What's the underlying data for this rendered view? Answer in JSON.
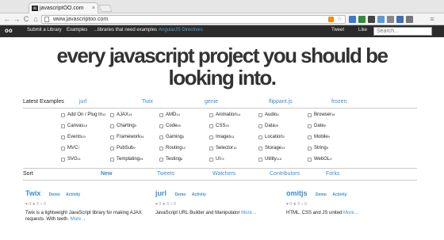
{
  "browser": {
    "tab_title": "javascriptOO.com",
    "favicon_text": "OO",
    "tab_close": "×",
    "url": "www.javascriptoo.com",
    "back_glyph": "←",
    "forward_glyph": "→",
    "reload_glyph": "C",
    "home_glyph": "⌂",
    "star_glyph": "☆",
    "extension_colors": [
      "#3b7bd4",
      "#2f8f3a",
      "#444444",
      "#5a9bd5",
      "#888888",
      "#3f6fb5",
      "#777777"
    ]
  },
  "nav": {
    "logo": "oo",
    "items": [
      {
        "label": "Submit a Library"
      },
      {
        "label": "Examples"
      },
      {
        "label": "...libraries that need examples"
      },
      {
        "label": "AngularJS Directives"
      },
      {
        "label": "Tweet"
      },
      {
        "label": "Like"
      }
    ],
    "search_placeholder": "Search..."
  },
  "hero": {
    "line1": "every javascript project you should be",
    "line2": "looking into."
  },
  "latest": {
    "label": "Latest Examples",
    "links": [
      "jurl",
      "Twix",
      "genie",
      "flippant.js",
      "frozen"
    ]
  },
  "tags": [
    {
      "name": "Add On / Plug In",
      "count": "12"
    },
    {
      "name": "AJAX",
      "count": "14"
    },
    {
      "name": "AMD",
      "count": "14"
    },
    {
      "name": "Animation",
      "count": "14"
    },
    {
      "name": "Audio",
      "count": "4"
    },
    {
      "name": "Browser",
      "count": "34"
    },
    {
      "name": "Canvas",
      "count": "18"
    },
    {
      "name": "Charting",
      "count": "9"
    },
    {
      "name": "Code",
      "count": "69"
    },
    {
      "name": "CSS",
      "count": "20"
    },
    {
      "name": "Data",
      "count": "29"
    },
    {
      "name": "Date",
      "count": "6"
    },
    {
      "name": "Events",
      "count": "20"
    },
    {
      "name": "Framework",
      "count": "34"
    },
    {
      "name": "Gaming",
      "count": "3"
    },
    {
      "name": "Images",
      "count": "11"
    },
    {
      "name": "Location",
      "count": "2"
    },
    {
      "name": "Mobile",
      "count": "9"
    },
    {
      "name": "MVC",
      "count": "7"
    },
    {
      "name": "PubSub",
      "count": "9"
    },
    {
      "name": "Routing",
      "count": "12"
    },
    {
      "name": "Selector",
      "count": "10"
    },
    {
      "name": "Storage",
      "count": "14"
    },
    {
      "name": "String",
      "count": "9"
    },
    {
      "name": "SVG",
      "count": "11"
    },
    {
      "name": "Templating",
      "count": "24"
    },
    {
      "name": "Testing",
      "count": "6"
    },
    {
      "name": "UI",
      "count": "73"
    },
    {
      "name": "Utility",
      "count": "115"
    },
    {
      "name": "WebGL",
      "count": "3"
    }
  ],
  "sort": {
    "label": "Sort",
    "options": [
      "New",
      "Tweets",
      "Watchers",
      "Contributors",
      "Forks"
    ]
  },
  "projects": [
    {
      "name": "Twix",
      "demo": "Demo",
      "activity": "Activity",
      "stats": "♥ 0   ★ 0   ⑂ 0",
      "desc": "Twix is a lightweight JavaScript library for making AJAX requests. With teeth.",
      "more": "More→"
    },
    {
      "name": "jurl",
      "demo": "Demo",
      "activity": "Activity",
      "stats": "♥ 0   ★ 0   ⑂ 0",
      "desc": "JavaScript URL Builder and Manipulator",
      "more": "More→"
    },
    {
      "name": "omitjs",
      "demo": "Demo",
      "activity": "Activity",
      "stats": "♥ 0   ★ 0   ⑂ 0",
      "desc": "HTML, CSS and JS united",
      "more": "More→"
    }
  ]
}
